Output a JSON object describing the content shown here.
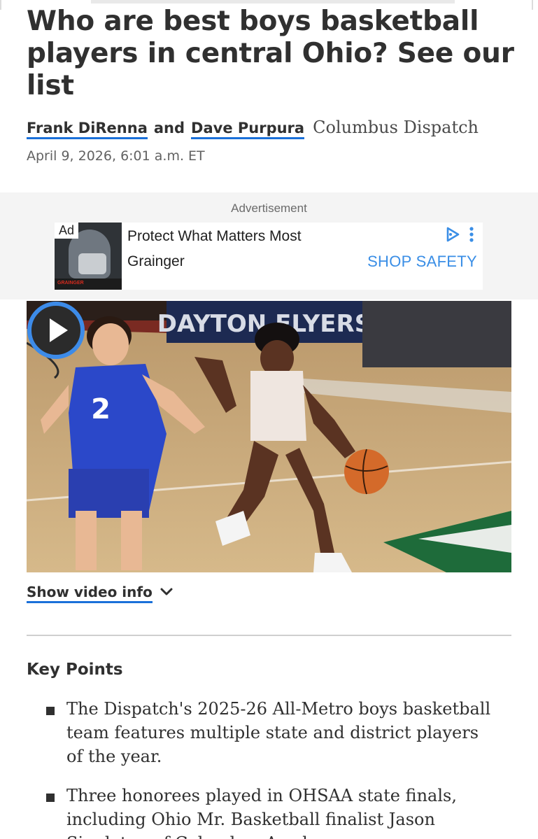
{
  "article": {
    "headline": "Who are best boys basketball players in central Ohio? See our list",
    "authors": [
      "Frank DiRenna",
      "Dave Purpura"
    ],
    "author_joiner": "and",
    "publication": "Columbus Dispatch",
    "timestamp": "April 9, 2026, 6:01 a.m. ET"
  },
  "ad": {
    "label": "Advertisement",
    "badge": "Ad",
    "title": "Protect What Matters Most",
    "sponsor": "Grainger",
    "cta": "SHOP SAFETY",
    "thumb_brand": "GRAINGER",
    "icons": [
      "adchoices-icon",
      "more-vertical-icon"
    ]
  },
  "video": {
    "show_info_label": "Show video info",
    "banner_text": "DAYTON FLYERS",
    "jersey_number": "2",
    "icons": [
      "play-icon",
      "chevron-down-icon"
    ]
  },
  "key_points": {
    "heading": "Key Points",
    "items": [
      "The Dispatch's 2025-26 All-Metro boys basketball team features multiple state and district players of the year.",
      "Three honorees played in OHSAA state finals, including Ohio Mr. Basketball finalist Jason Singleton of Columbus Academy."
    ]
  },
  "colors": {
    "link_underline": "#1a70d9",
    "cta_blue": "#3a8ee6",
    "text": "#303030",
    "play_ring": "#3d8be8"
  }
}
